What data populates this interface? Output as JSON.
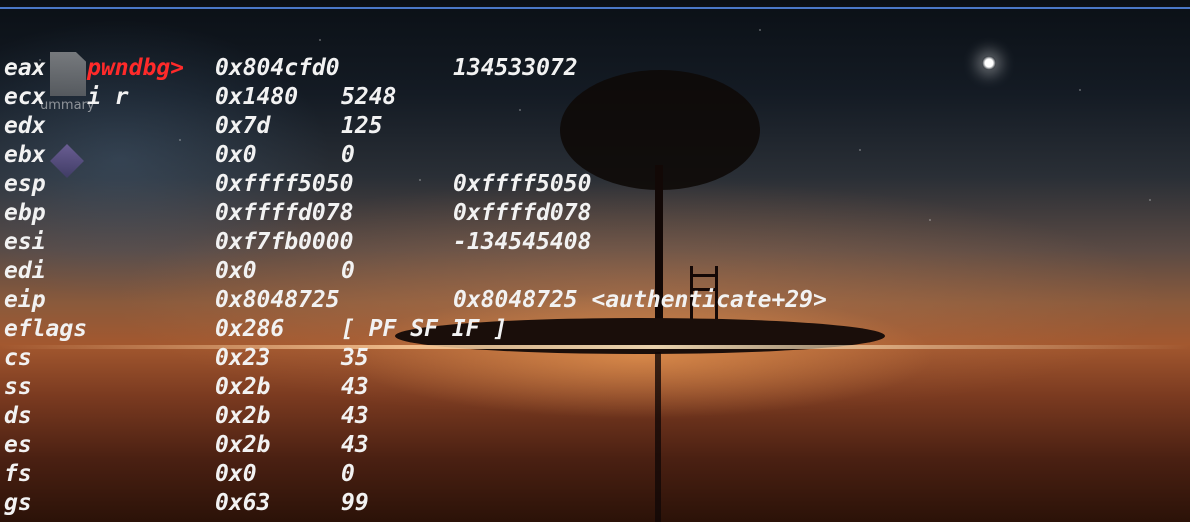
{
  "window": {
    "accent_color": "#4a78c8",
    "prompt_color": "#ff2a2a",
    "text_color": "#f2f2f2"
  },
  "desktop": {
    "icon_label": "ummary"
  },
  "prompt": {
    "label": "pwndbg>",
    "command": "i r"
  },
  "registers": [
    {
      "name": "eax",
      "hex": "0x804cfd0",
      "value": "134533072"
    },
    {
      "name": "ecx",
      "hex": "0x1480",
      "value": "5248"
    },
    {
      "name": "edx",
      "hex": "0x7d",
      "value": "125"
    },
    {
      "name": "ebx",
      "hex": "0x0",
      "value": "0"
    },
    {
      "name": "esp",
      "hex": "0xffff5050",
      "value": "0xffff5050"
    },
    {
      "name": "ebp",
      "hex": "0xffffd078",
      "value": "0xffffd078"
    },
    {
      "name": "esi",
      "hex": "0xf7fb0000",
      "value": "-134545408"
    },
    {
      "name": "edi",
      "hex": "0x0",
      "value": "0"
    },
    {
      "name": "eip",
      "hex": "0x8048725",
      "value": "0x8048725 <authenticate+29>"
    },
    {
      "name": "eflags",
      "hex": "0x286",
      "value": "[ PF SF IF ]"
    },
    {
      "name": "cs",
      "hex": "0x23",
      "value": "35"
    },
    {
      "name": "ss",
      "hex": "0x2b",
      "value": "43"
    },
    {
      "name": "ds",
      "hex": "0x2b",
      "value": "43"
    },
    {
      "name": "es",
      "hex": "0x2b",
      "value": "43"
    },
    {
      "name": "fs",
      "hex": "0x0",
      "value": "0"
    },
    {
      "name": "gs",
      "hex": "0x63",
      "value": "99"
    }
  ]
}
